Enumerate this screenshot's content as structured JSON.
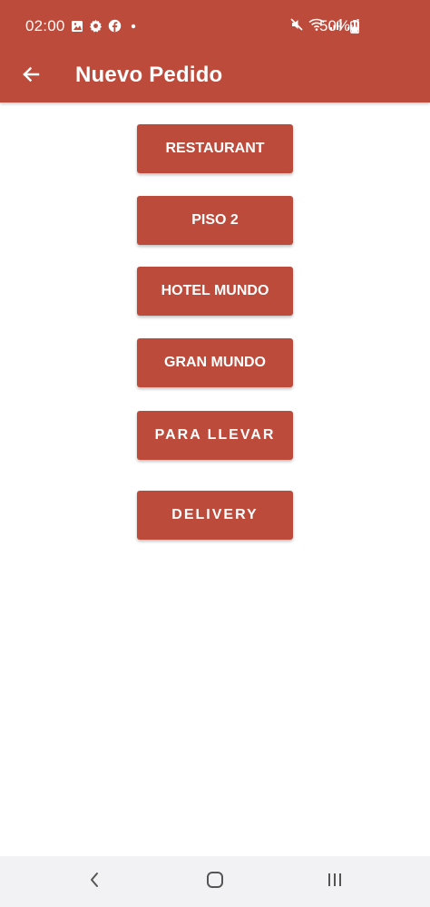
{
  "status_bar": {
    "time": "02:00",
    "battery": "50%",
    "icons_left": [
      "image-icon",
      "gear-icon",
      "facebook-icon",
      "dot-icon"
    ],
    "icons_right": [
      "mute-icon",
      "wifi-icon",
      "signal-icon",
      "signal-icon"
    ]
  },
  "app_bar": {
    "title": "Nuevo Pedido",
    "back_icon": "arrow-left-icon"
  },
  "options": [
    {
      "label": "RESTAURANT"
    },
    {
      "label": "PISO 2"
    },
    {
      "label": "HOTEL MUNDO"
    },
    {
      "label": "GRAN MUNDO"
    },
    {
      "label": "PARA LLEVAR"
    },
    {
      "label": "DELIVERY"
    }
  ],
  "nav_bar": {
    "buttons": [
      "back-icon",
      "home-icon",
      "recents-icon"
    ]
  },
  "colors": {
    "primary": "#bd4b3b",
    "on_primary": "#ffffff",
    "background": "#ffffff",
    "nav_background": "#f2f2f4",
    "nav_icon": "#555555"
  }
}
